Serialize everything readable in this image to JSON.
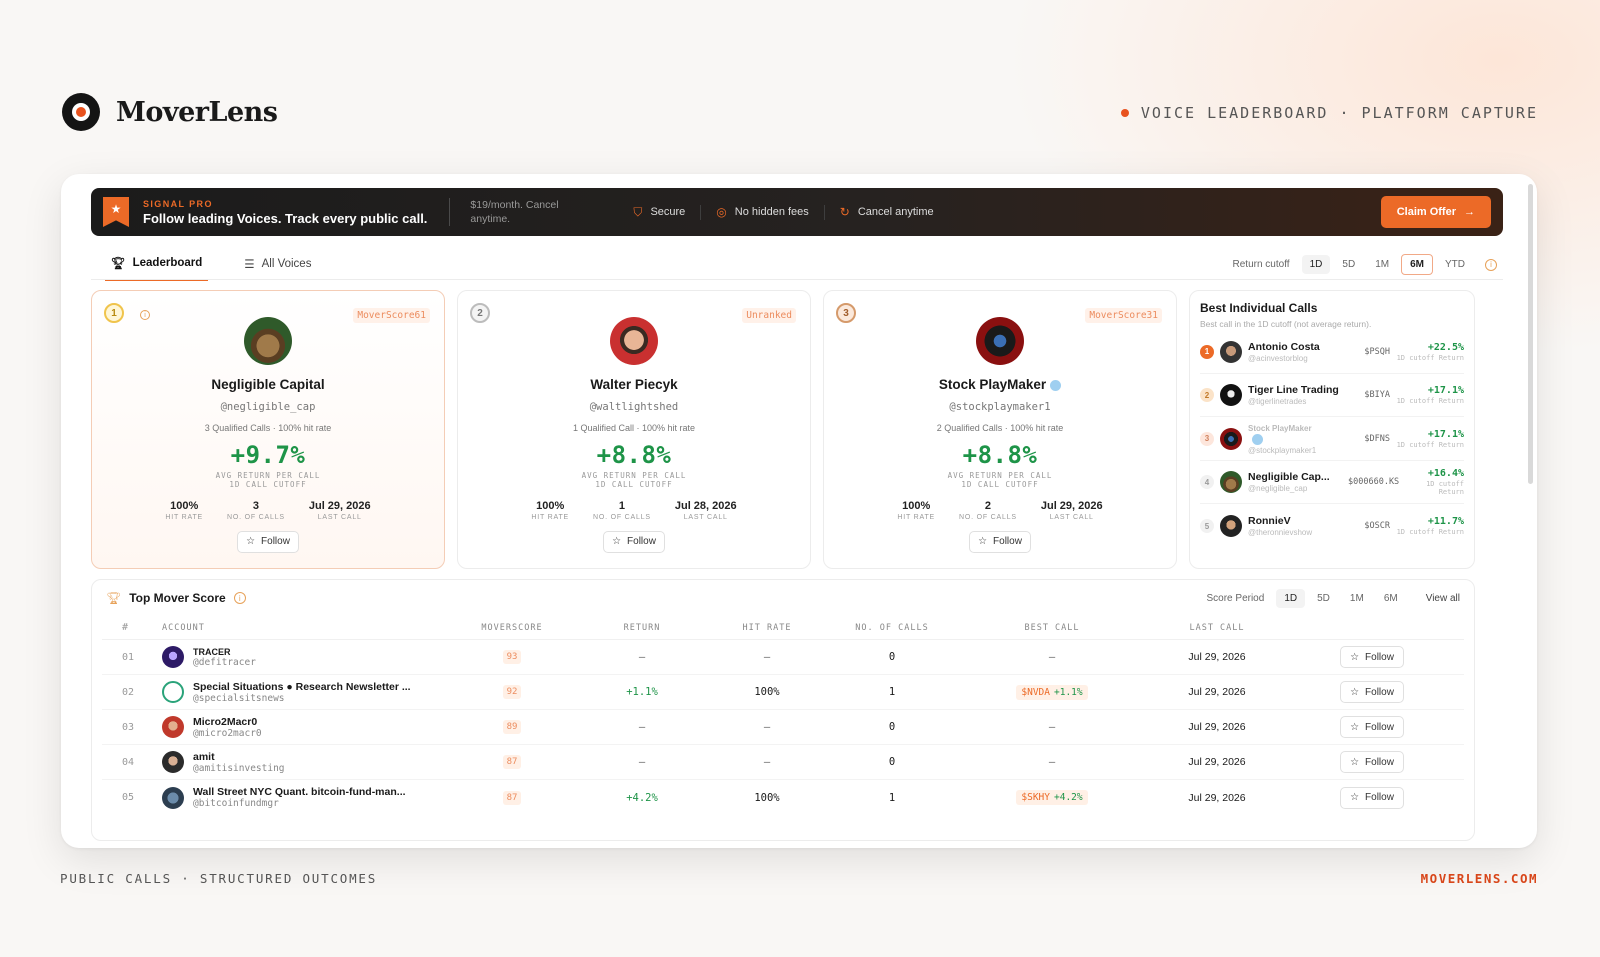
{
  "header": {
    "brand": "MoverLens",
    "tagline": "VOICE LEADERBOARD · PLATFORM CAPTURE",
    "accent": "#e8521e"
  },
  "footer": {
    "left": "PUBLIC CALLS · STRUCTURED OUTCOMES",
    "right": "MOVERLENS.COM"
  },
  "banner": {
    "kicker": "SIGNAL PRO",
    "title": "Follow leading Voices. Track every public call.",
    "price": "$19/month. Cancel anytime.",
    "perks": [
      "Secure",
      "No hidden fees",
      "Cancel anytime"
    ],
    "cta": "Claim Offer"
  },
  "tabs": [
    {
      "label": "Leaderboard",
      "icon": "trophy-icon",
      "active": true
    },
    {
      "label": "All Voices",
      "icon": "list-icon",
      "active": false
    }
  ],
  "return_cutoff": {
    "label": "Return cutoff",
    "options": [
      "1D",
      "5D",
      "1M",
      "6M",
      "YTD"
    ],
    "selected": "6M"
  },
  "cards": [
    {
      "rank": "1",
      "badge": "MoverScore61",
      "name": "Negligible Capital",
      "handle": "@negligible_cap",
      "meta": "3 Qualified Calls · 100% hit rate",
      "return": "+9.7%",
      "return_label_1": "AVG RETURN PER CALL",
      "return_label_2": "1D CALL CUTOFF",
      "hit_rate": "100%",
      "hit_rate_label": "HIT RATE",
      "calls": "3",
      "calls_label": "NO. OF CALLS",
      "last_call": "Jul 29, 2026",
      "last_call_label": "LAST CALL",
      "follow": "Follow",
      "verified": false
    },
    {
      "rank": "2",
      "badge": "Unranked",
      "name": "Walter Piecyk",
      "handle": "@waltlightshed",
      "meta": "1 Qualified Call · 100% hit rate",
      "return": "+8.8%",
      "return_label_1": "AVG RETURN PER CALL",
      "return_label_2": "1D CALL CUTOFF",
      "hit_rate": "100%",
      "hit_rate_label": "HIT RATE",
      "calls": "1",
      "calls_label": "NO. OF CALLS",
      "last_call": "Jul 28, 2026",
      "last_call_label": "LAST CALL",
      "follow": "Follow",
      "verified": false
    },
    {
      "rank": "3",
      "badge": "MoverScore31",
      "name": "Stock PlayMaker",
      "handle": "@stockplaymaker1",
      "meta": "2 Qualified Calls · 100% hit rate",
      "return": "+8.8%",
      "return_label_1": "AVG RETURN PER CALL",
      "return_label_2": "1D CALL CUTOFF",
      "hit_rate": "100%",
      "hit_rate_label": "HIT RATE",
      "calls": "2",
      "calls_label": "NO. OF CALLS",
      "last_call": "Jul 29, 2026",
      "last_call_label": "LAST CALL",
      "follow": "Follow",
      "verified": true
    }
  ],
  "best_calls": {
    "title": "Best Individual Calls",
    "subtitle": "Best call in the 1D cutoff (not average return).",
    "items": [
      {
        "rank": "1",
        "name": "Antonio Costa",
        "handle": "@acinvestorblog",
        "ticker": "$PSQH",
        "pct": "+22.5%",
        "sub": "1D cutoff Return"
      },
      {
        "rank": "2",
        "name": "Tiger Line Trading",
        "handle": "@tigerlinetrades",
        "ticker": "$BIYA",
        "pct": "+17.1%",
        "sub": "1D cutoff Return"
      },
      {
        "rank": "3",
        "name": "Stock PlayMaker",
        "handle": "@stockplaymaker1",
        "ticker": "$DFNS",
        "pct": "+17.1%",
        "sub": "1D cutoff Return"
      },
      {
        "rank": "4",
        "name": "Negligible Cap...",
        "handle": "@negligible_cap",
        "ticker": "$000660.KS",
        "pct": "+16.4%",
        "sub": "1D cutoff Return"
      },
      {
        "rank": "5",
        "name": "RonnieV",
        "handle": "@theronnievshow",
        "ticker": "$OSCR",
        "pct": "+11.7%",
        "sub": "1D cutoff Return"
      }
    ]
  },
  "top_mover": {
    "title": "Top Mover Score",
    "period_label": "Score Period",
    "periods": [
      "1D",
      "5D",
      "1M",
      "6M"
    ],
    "selected": "1D",
    "view_all": "View all",
    "columns": [
      "#",
      "ACCOUNT",
      "MOVERSCORE",
      "RETURN",
      "HIT RATE",
      "NO. OF CALLS",
      "BEST CALL",
      "LAST CALL"
    ],
    "rows": [
      {
        "idx": "01",
        "name": "TRACER",
        "handle": "@defitracer",
        "score": "93",
        "ret": "–",
        "hit": "–",
        "calls": "0",
        "best_ticker": "",
        "best_pct": "",
        "best_dash": "–",
        "last": "Jul 29, 2026",
        "follow": "Follow"
      },
      {
        "idx": "02",
        "name": "Special Situations ● Research Newsletter ...",
        "handle": "@specialsitsnews",
        "score": "92",
        "ret": "+1.1%",
        "hit": "100%",
        "calls": "1",
        "best_ticker": "$NVDA",
        "best_pct": "+1.1%",
        "best_dash": "",
        "last": "Jul 29, 2026",
        "follow": "Follow"
      },
      {
        "idx": "03",
        "name": "Micro2Macr0",
        "handle": "@micro2macr0",
        "score": "89",
        "ret": "–",
        "hit": "–",
        "calls": "0",
        "best_ticker": "",
        "best_pct": "",
        "best_dash": "–",
        "last": "Jul 29, 2026",
        "follow": "Follow"
      },
      {
        "idx": "04",
        "name": "amit",
        "handle": "@amitisinvesting",
        "score": "87",
        "ret": "–",
        "hit": "–",
        "calls": "0",
        "best_ticker": "",
        "best_pct": "",
        "best_dash": "–",
        "last": "Jul 29, 2026",
        "follow": "Follow"
      },
      {
        "idx": "05",
        "name": "Wall Street NYC Quant. bitcoin-fund-man...",
        "handle": "@bitcoinfundmgr",
        "score": "87",
        "ret": "+4.2%",
        "hit": "100%",
        "calls": "1",
        "best_ticker": "$SKHY",
        "best_pct": "+4.2%",
        "best_dash": "",
        "last": "Jul 29, 2026",
        "follow": "Follow"
      }
    ]
  }
}
